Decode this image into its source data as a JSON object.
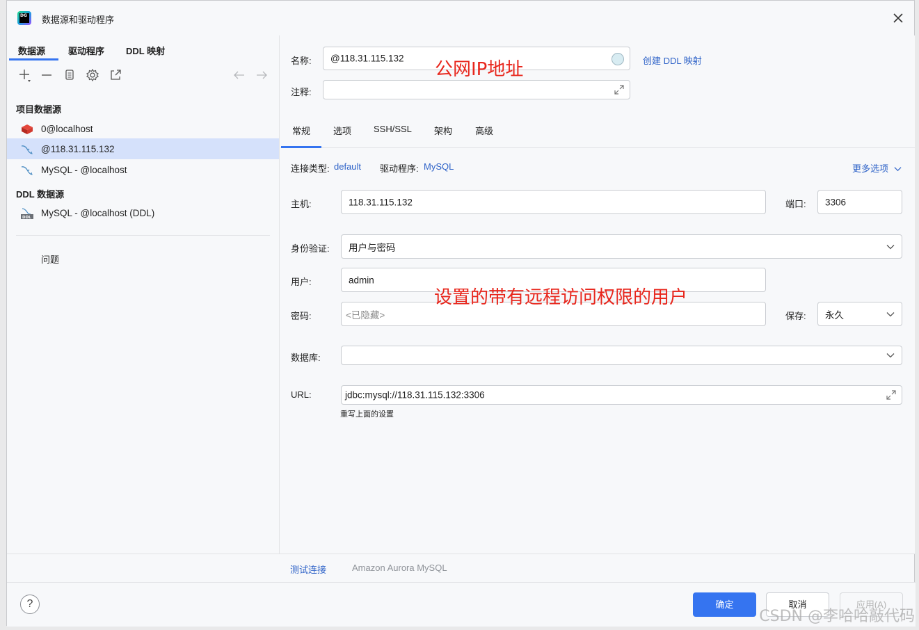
{
  "window": {
    "title": "数据源和驱动程序"
  },
  "left_tabs": [
    "数据源",
    "驱动程序",
    "DDL 映射"
  ],
  "sections": {
    "project": "项目数据源",
    "ddl": "DDL 数据源",
    "problems": "问题"
  },
  "datasources": [
    {
      "label": "0@localhost",
      "icon": "redis-icon"
    },
    {
      "label": "@118.31.115.132",
      "icon": "mysql-icon",
      "selected": true
    },
    {
      "label": "MySQL - @localhost",
      "icon": "mysql-icon"
    }
  ],
  "ddl_datasources": [
    {
      "label": "MySQL - @localhost (DDL)",
      "icon": "ddl-mysql-icon"
    }
  ],
  "form": {
    "name_label": "名称:",
    "name_value": "@118.31.115.132",
    "create_ddl_link": "创建 DDL 映射",
    "comment_label": "注释:",
    "comment_value": "",
    "tabs": [
      "常规",
      "选项",
      "SSH/SSL",
      "架构",
      "高级"
    ],
    "conn_type_label": "连接类型:",
    "conn_type_value": "default",
    "driver_label": "驱动程序:",
    "driver_value": "MySQL",
    "more_options": "更多选项",
    "host_label": "主机:",
    "host_value": "118.31.115.132",
    "port_label": "端口:",
    "port_value": "3306",
    "auth_label": "身份验证:",
    "auth_value": "用户与密码",
    "user_label": "用户:",
    "user_value": "admin",
    "password_label": "密码:",
    "password_placeholder": "<已隐藏>",
    "save_label": "保存:",
    "save_value": "永久",
    "database_label": "数据库:",
    "database_value": "",
    "url_label": "URL:",
    "url_value": "jdbc:mysql://118.31.115.132:3306",
    "url_note": "重写上面的设置",
    "test_connection": "测试连接",
    "driver_hint": "Amazon Aurora MySQL"
  },
  "annotations": {
    "public_ip": "公网IP地址",
    "remote_user": "设置的带有远程访问权限的用户"
  },
  "footer": {
    "help": "?",
    "ok": "确定",
    "cancel": "取消",
    "apply": "应用(A)"
  },
  "watermark": "CSDN @李哈哈敲代码",
  "colors": {
    "accent": "#3574f0",
    "link": "#2f63c8",
    "annotation": "#e8261c",
    "selection": "#d5e1fb"
  }
}
